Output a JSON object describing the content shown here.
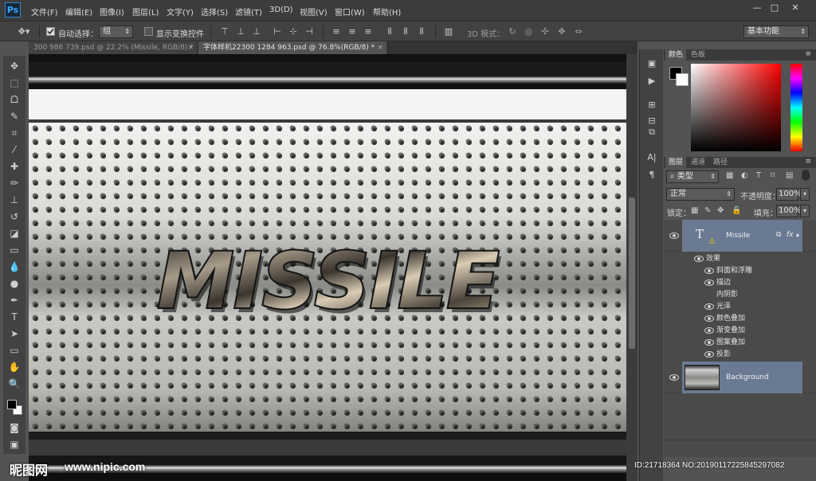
{
  "app": {
    "logo": "Ps"
  },
  "menu": [
    "文件(F)",
    "编辑(E)",
    "图像(I)",
    "图层(L)",
    "文字(Y)",
    "选择(S)",
    "滤镜(T)",
    "3D(D)",
    "视图(V)",
    "窗口(W)",
    "帮助(H)"
  ],
  "window_controls": {
    "minimize": "—",
    "maximize": "□",
    "close": "✕"
  },
  "options": {
    "auto_select_label": "自动选择：",
    "auto_select_value": "组",
    "show_transform_label": "显示变换控件",
    "mode3d_label": "3D 模式：",
    "workspace": "基本功能"
  },
  "tabs": [
    {
      "label": "300 986 739.psd @ 22.2% (Missile, RGB/8) *",
      "close": "×"
    },
    {
      "label": "字体样机22300 1284 963.psd @ 76.8%(RGB/8) *",
      "close": "×"
    }
  ],
  "canvas": {
    "text": "MISSILE"
  },
  "color_panel": {
    "tabs": [
      "颜色",
      "色板"
    ]
  },
  "layers_panel": {
    "tabs": [
      "图层",
      "通道",
      "路径"
    ],
    "filter_label": "类型",
    "blend_mode": "正常",
    "opacity_label": "不透明度：",
    "opacity_value": "100%",
    "lock_label": "锁定：",
    "fill_label": "填充：",
    "fill_value": "100%",
    "layers": [
      {
        "name": "Missile",
        "kind": "text",
        "thumb": "T",
        "fx": "fx"
      },
      {
        "name": "Background",
        "kind": "image"
      }
    ],
    "effects_label": "效果",
    "effects": [
      {
        "name": "斜面和浮雕",
        "visible": true
      },
      {
        "name": "描边",
        "visible": true
      },
      {
        "name": "内阴影",
        "visible": false
      },
      {
        "name": "光泽",
        "visible": true
      },
      {
        "name": "颜色叠加",
        "visible": true
      },
      {
        "name": "渐变叠加",
        "visible": true
      },
      {
        "name": "图案叠加",
        "visible": true
      },
      {
        "name": "投影",
        "visible": true
      }
    ]
  },
  "watermark": {
    "logo": "昵图网",
    "url": "www.nipic.com",
    "id_text": "ID:21718364 NO:20190117225845297082"
  },
  "colors": {
    "selected_layer": "#6a7a93",
    "accent": "#31a8ff"
  }
}
